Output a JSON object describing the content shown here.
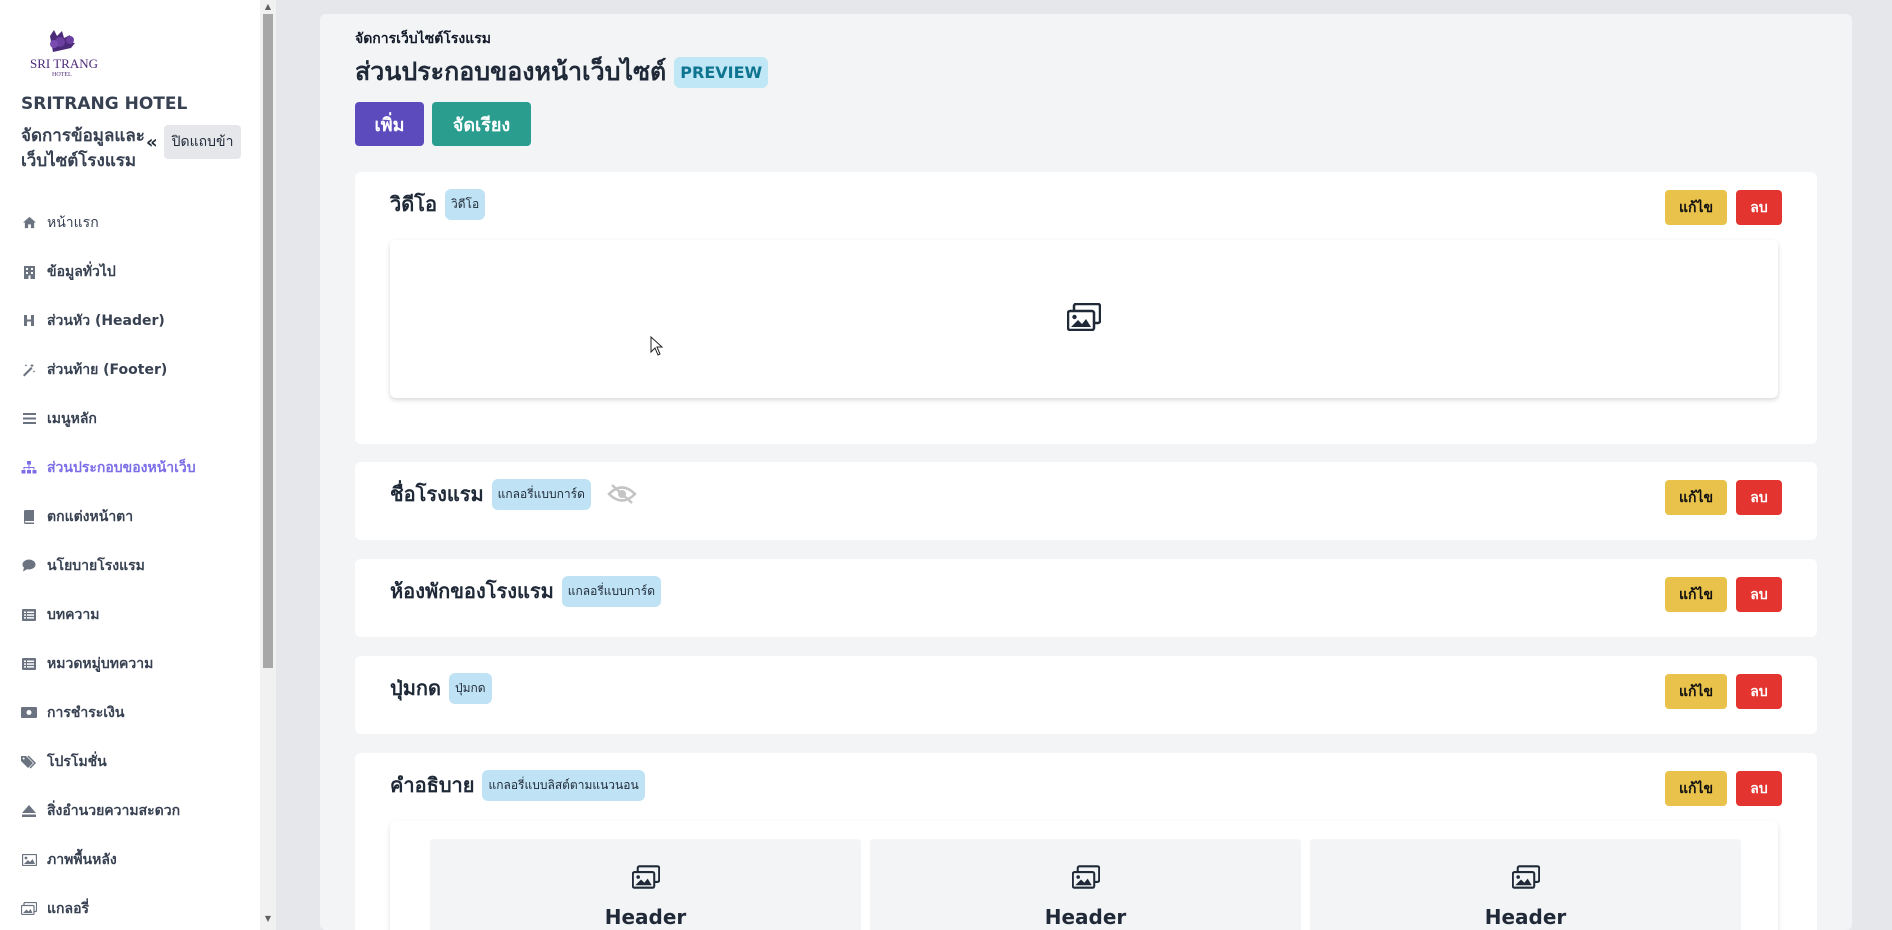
{
  "sidebar": {
    "logo_text": "SRI TRANG",
    "logo_subtext": "HOTEL",
    "brand": "SRITRANG HOTEL",
    "subtitle": "จัดการข้อมูลและเว็บไซต์โรงแรม",
    "collapse_label": "ปิดแถบข้า",
    "items": [
      {
        "label": "หน้าแรก",
        "icon": "home-icon"
      },
      {
        "label": "ข้อมูลทั่วไป",
        "icon": "building-icon"
      },
      {
        "label": "ส่วนหัว (Header)",
        "icon": "heading-icon"
      },
      {
        "label": "ส่วนท้าย (Footer)",
        "icon": "magic-icon"
      },
      {
        "label": "เมนูหลัก",
        "icon": "bars-icon"
      },
      {
        "label": "ส่วนประกอบของหน้าเว็บ",
        "icon": "sitemap-icon",
        "active": true
      },
      {
        "label": "ตกแต่งหน้าตา",
        "icon": "book-icon"
      },
      {
        "label": "นโยบายโรงแรม",
        "icon": "comment-icon"
      },
      {
        "label": "บทความ",
        "icon": "list-icon"
      },
      {
        "label": "หมวดหมู่บทความ",
        "icon": "list-icon"
      },
      {
        "label": "การชำระเงิน",
        "icon": "money-icon"
      },
      {
        "label": "โปรโมชั่น",
        "icon": "tags-icon"
      },
      {
        "label": "สิ่งอำนวยความสะดวก",
        "icon": "eject-icon"
      },
      {
        "label": "ภาพพื้นหลัง",
        "icon": "image-icon"
      },
      {
        "label": "แกลอรี่",
        "icon": "images-icon"
      }
    ]
  },
  "main": {
    "breadcrumb": "จัดการเว็บไซต์โรงแรม",
    "title": "ส่วนประกอบของหน้าเว็บไซต์",
    "preview_badge": "PREVIEW",
    "add_label": "เพิ่ม",
    "sort_label": "จัดเรียง",
    "edit_label": "แก้ไข",
    "delete_label": "ลบ",
    "sections": [
      {
        "title": "วิดีโอ",
        "tag": "วิดีโอ"
      },
      {
        "title": "ชื่อโรงแรม",
        "tag": "แกลอรี่แบบการ์ด",
        "hidden": true
      },
      {
        "title": "ห้องพักของโรงแรม",
        "tag": "แกลอรี่แบบการ์ด"
      },
      {
        "title": "ปุ่มกด",
        "tag": "ปุ่มกด"
      },
      {
        "title": "คำอธิบาย",
        "tag": "แกลอรี่แบบลิสต์ตามแนวนอน"
      }
    ],
    "gallery_headers": [
      "Header",
      "Header",
      "Header"
    ]
  },
  "colors": {
    "accent": "#5b4bbd",
    "sort": "#2a9d8f",
    "edit": "#e8c24a",
    "delete": "#e3342f",
    "active_nav": "#7c6ee6"
  }
}
